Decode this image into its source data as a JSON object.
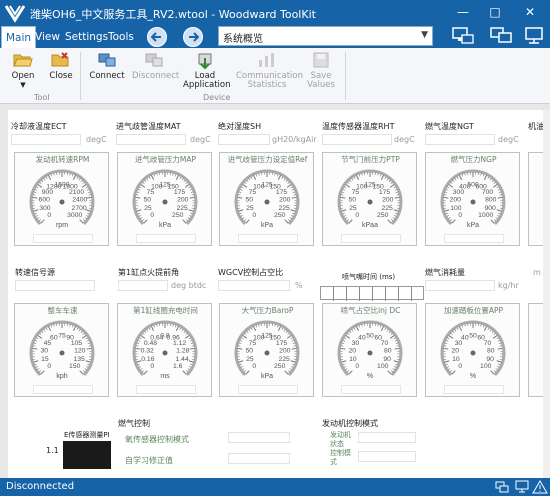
{
  "window": {
    "title": "潍柴OH6_中文服务工具_RV2.wtool - Woodward ToolKit",
    "minimize": "—",
    "maximize": "□",
    "close": "✕"
  },
  "menu": {
    "main": "Main",
    "view": "View",
    "settings": "Settings",
    "tools": "Tools"
  },
  "address": {
    "value": "系统概览"
  },
  "ribbon": {
    "open": "Open",
    "close": "Close",
    "connect": "Connect",
    "disconnect": "Disconnect",
    "load1": "Load",
    "load2": "Application",
    "comm1": "Communication",
    "comm2": "Statistics",
    "save1": "Save",
    "save2": "Values",
    "group_tool": "Tool",
    "group_device": "Device"
  },
  "row1": [
    {
      "label": "冷却液温度ECT",
      "unit": "degC"
    },
    {
      "label": "进气歧管温度MAT",
      "unit": "degC"
    },
    {
      "label": "绝对湿度SH",
      "unit": "gH20/kgAir"
    },
    {
      "label": "温度传感器温度RHT",
      "unit": "degC"
    },
    {
      "label": "燃气温度NGT",
      "unit": "degC"
    },
    {
      "label": "机油",
      "unit": ""
    }
  ],
  "gauges1": [
    {
      "title": "发动机转速RPM",
      "ticks": [
        "0",
        "300",
        "600",
        "900",
        "1200",
        "1500",
        "1800",
        "2100",
        "2400",
        "2700",
        "3000"
      ],
      "unit": "rpm"
    },
    {
      "title": "进气歧管压力MAP",
      "ticks": [
        "0",
        "25",
        "50",
        "75",
        "100",
        "125",
        "150",
        "175",
        "200",
        "225",
        "250"
      ],
      "unit": "kPa"
    },
    {
      "title": "进气歧管压力设定值Ref",
      "ticks": [
        "0",
        "25",
        "50",
        "75",
        "100",
        "125",
        "150",
        "175",
        "200",
        "225",
        "250"
      ],
      "unit": "kPa"
    },
    {
      "title": "节气门前压力PTP",
      "ticks": [
        "0",
        "25",
        "50",
        "75",
        "100",
        "125",
        "150",
        "175",
        "200",
        "225",
        "250"
      ],
      "unit": "kPaa"
    },
    {
      "title": "燃气压力NGP",
      "ticks": [
        "0",
        "100",
        "200",
        "300",
        "400",
        "500",
        "600",
        "700",
        "800",
        "900",
        "1000"
      ],
      "unit": "kPa"
    }
  ],
  "row2": [
    {
      "label": "转速信号源",
      "unit": ""
    },
    {
      "label": "第1缸点火提前角",
      "unit": "deg btdc"
    },
    {
      "label": "WGCV控制占空比",
      "unit": "%"
    },
    {
      "label": "喷气嘴时间 (ms)",
      "unit": ""
    },
    {
      "label": "燃气消耗量",
      "unit": "kg/hr"
    },
    {
      "label": "",
      "unit": "m"
    }
  ],
  "gauges2": [
    {
      "title": "整车车速",
      "ticks": [
        "0",
        "15",
        "30",
        "45",
        "60",
        "75",
        "90",
        "105",
        "120",
        "135",
        "150"
      ],
      "unit": "kph"
    },
    {
      "title": "第1缸线圈充电时间",
      "ticks": [
        "0",
        "0.16",
        "0.32",
        "0.48",
        "0.64",
        "0.8",
        "0.96",
        "1.12",
        "1.28",
        "1.44",
        "1.6"
      ],
      "unit": "ms"
    },
    {
      "title": "大气压力BaroP",
      "ticks": [
        "0",
        "25",
        "50",
        "75",
        "100",
        "125",
        "150",
        "175",
        "200",
        "225",
        "250"
      ],
      "unit": "kPa"
    },
    {
      "title": "喷气占空比inj DC",
      "ticks": [
        "0",
        "10",
        "20",
        "30",
        "40",
        "50",
        "60",
        "70",
        "80",
        "90",
        "100"
      ],
      "unit": "%"
    },
    {
      "title": "加速踏板位置APP",
      "ticks": [
        "0",
        "10",
        "20",
        "30",
        "40",
        "50",
        "60",
        "70",
        "80",
        "90",
        "100"
      ],
      "unit": "%"
    }
  ],
  "bottom": {
    "sensor_label": "E传感器测量PI",
    "row_index": "1.1",
    "gas_control": "燃气控制",
    "sensor_mode": "氧传感器控制模式",
    "self_learn": "自学习修正值",
    "engine_mode": "发动机控制模式",
    "engine_state_1": "发动机",
    "engine_state_2": "状态",
    "ctrl_mode_1": "控制模",
    "ctrl_mode_2": "式"
  },
  "status": {
    "text": "Disconnected"
  },
  "colors": {
    "accent": "#1663a8",
    "gauge_frame": "#b8c6b8"
  }
}
